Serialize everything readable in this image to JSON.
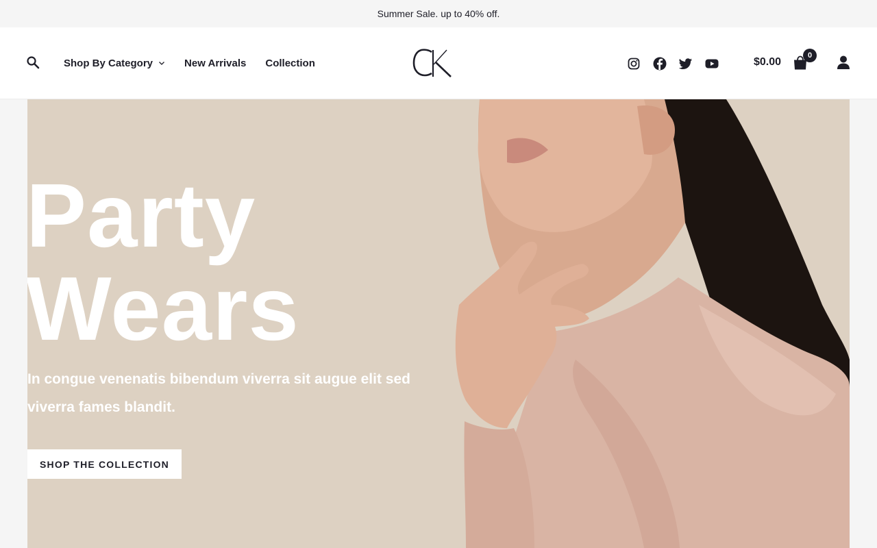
{
  "announcement": {
    "text": "Summer Sale. up to 40% off."
  },
  "header": {
    "nav": [
      {
        "label": "Shop By Category",
        "has_dropdown": true
      },
      {
        "label": "New Arrivals"
      },
      {
        "label": "Collection"
      }
    ],
    "logo_text": "CK",
    "social": [
      "instagram-icon",
      "facebook-icon",
      "twitter-icon",
      "youtube-icon"
    ],
    "cart": {
      "total": "$0.00",
      "count": "0"
    }
  },
  "hero": {
    "title_line1": "Party",
    "title_line2": "Wears",
    "subtitle": "In congue venenatis bibendum viverra sit augue elit sed viverra fames blandit.",
    "cta_label": "SHOP THE COLLECTION"
  },
  "colors": {
    "topbar_bg": "#f5f5f5",
    "hero_bg": "#ddd1c2",
    "text_dark": "#1e1e28",
    "blouse": "#d9b4a4"
  }
}
